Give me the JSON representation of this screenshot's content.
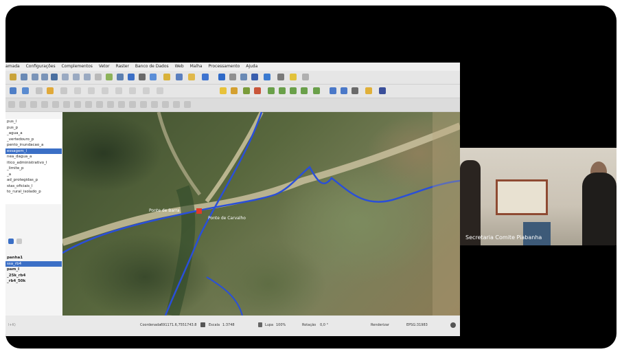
{
  "menubar": {
    "items": [
      "amada",
      "Configurações",
      "Complementos",
      "Vetor",
      "Raster",
      "Banco de Dados",
      "Web",
      "Malha",
      "Processamento",
      "Ajuda"
    ]
  },
  "layers_top": [
    "pus_l",
    "pus_p",
    "_agua_a",
    "_vertedouro_p",
    "pento_inundacao_a",
    "essagem_l",
    "nea_dagua_a",
    "itico_administrativo_l",
    "_limite_p",
    "_a",
    "ad_protegidas_p",
    "stas_oficiais_l",
    "to_rural_isolado_p"
  ],
  "layers_bottom": [
    "panha1",
    "ssa_rb4",
    "pam_l",
    "_25k_rb4",
    "_rb4_50k"
  ],
  "map_labels": {
    "bridge": "Ponte de Barra",
    "road": "Ponte de Carvalho"
  },
  "statusbar": {
    "coord_label": "Coordenada",
    "coord_value": "691171.6,7551743.8",
    "scale_label": "Escala",
    "scale_value": "1:3748",
    "lupa_label": "Lupa",
    "lupa_value": "100%",
    "rot_label": "Rotação",
    "rot_value": "0,0 °",
    "render_label": "Renderizar",
    "crs": "EPSG:31983",
    "left_hint": "l+K)"
  },
  "participant": {
    "name": "Secretaria Comite Piabanha"
  },
  "colors": {
    "selection": "#3b6fc6",
    "river": "#2a4fd8"
  }
}
